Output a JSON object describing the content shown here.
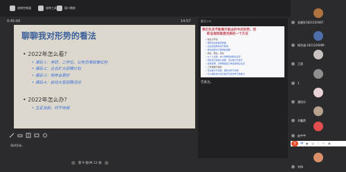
{
  "topbar": {
    "items": [
      {
        "label": "放映控制器"
      },
      {
        "label": "放映工具"
      },
      {
        "label": "窗口播放"
      }
    ]
  },
  "timer": {
    "elapsed": "0:45:00",
    "clock": "14:57"
  },
  "slide": {
    "title": "聊聊我对形势的看法",
    "sections": [
      {
        "heading": "• 2022年怎么看？",
        "bullets": [
          "• 课后-1：考研、二学位、公务员等政策红利",
          "• 课后-2：企业扩大招聘计划",
          "• 课后-3：明年会更好",
          "• 课后-4：启动大型招聘活动"
        ]
      },
      {
        "heading": "• 2022年怎么办？",
        "bullets": [
          "• 立足当前，时不待我"
        ]
      }
    ]
  },
  "tools": {
    "label": "演讲开始..."
  },
  "pager": {
    "text": "第 9 张/共 12 张"
  },
  "right_panel": {
    "top_text": "备注(15)",
    "doc_title_1": "我们生活不能离开就业的今后形势，但",
    "doc_title_2": "职业规划就是完美的一个方法",
    "doc_lines": [
      "• 就业大环境",
      "• 国家出台的各项政策",
      "• 企业的招聘情况与预测",
      "• 岗位的变化与需求的发展",
      "• 就业，职业，创业",
      "• 从个人出发，本人到规划的职业生涯",
      "• 培养自己的核心技能，专业能力与技巧",
      "• 如何选择，怎样准备自己未来的职业生活",
      "• 工作技能与素养",
      "• 专业能力与实践，团队协作与沟通",
      "• 与人相处的方法与技巧与合作学习的能力"
    ],
    "caption": "无备注。"
  },
  "members": [
    {
      "name": "金紫轩1821220067",
      "color": "#b0733f"
    },
    {
      "name": "杨世涵 1821220089",
      "color": "#4d6ea8"
    },
    {
      "name": "王昊",
      "color": "#c7c2bf"
    },
    {
      "name": "1",
      "color": "#8f8f8f"
    },
    {
      "name": "潘佳乐",
      "color": "#e8d2d6"
    },
    {
      "name": "刘鑫然",
      "color": "#b7a28c"
    },
    {
      "name": "赵中宇",
      "color": "#e24e4e"
    },
    {
      "name": "刘玮",
      "color": "#d98f6a"
    }
  ],
  "strip": {
    "s_label": "S",
    "zh_label": "中"
  }
}
